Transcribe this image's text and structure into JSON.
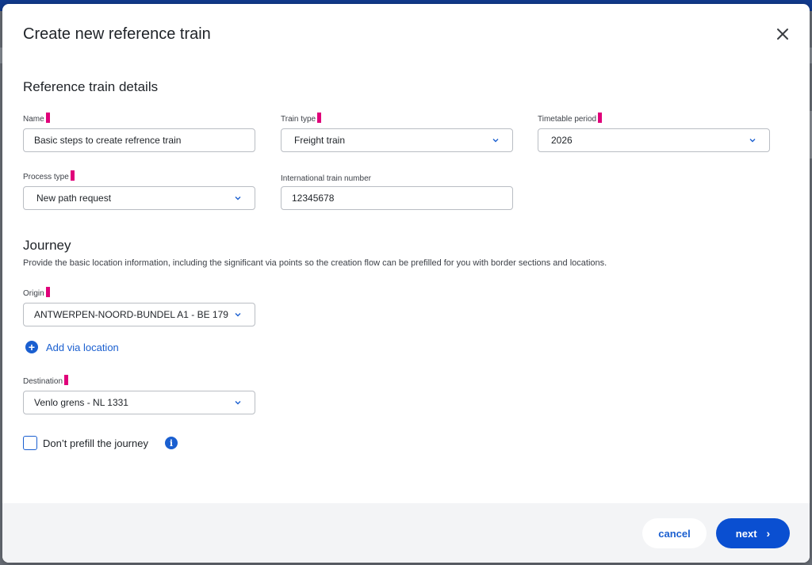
{
  "modal": {
    "title": "Create new reference train",
    "close_icon": "close-icon"
  },
  "details": {
    "section_title": "Reference train details",
    "name": {
      "label": "Name",
      "value": "Basic steps to create refrence train"
    },
    "train_type": {
      "label": "Train type",
      "value": "Freight train"
    },
    "timetable_period": {
      "label": "Timetable period",
      "value": "2026"
    },
    "process_type": {
      "label": "Process type",
      "value": "New path request"
    },
    "international_train_number": {
      "label": "International train number",
      "value": "12345678"
    }
  },
  "journey": {
    "section_title": "Journey",
    "description": "Provide the basic location information, including the significant via points so the creation flow can be prefilled for you with border sections and locations.",
    "origin": {
      "label": "Origin",
      "value": "ANTWERPEN-NOORD-BUNDEL A1 - BE 179"
    },
    "add_via_label": "Add via location",
    "destination": {
      "label": "Destination",
      "value": "Venlo grens - NL 1331"
    },
    "dont_prefill": {
      "label": "Don’t prefill the journey",
      "checked": false
    },
    "info_icon_glyph": "i"
  },
  "footer": {
    "cancel_label": "cancel",
    "next_label": "next",
    "next_arrow": "›"
  },
  "colors": {
    "accent": "#1a5fd0",
    "primary_button": "#0a4fd1",
    "required_marker": "#e0007a",
    "footer_bg": "#f3f4f6"
  }
}
